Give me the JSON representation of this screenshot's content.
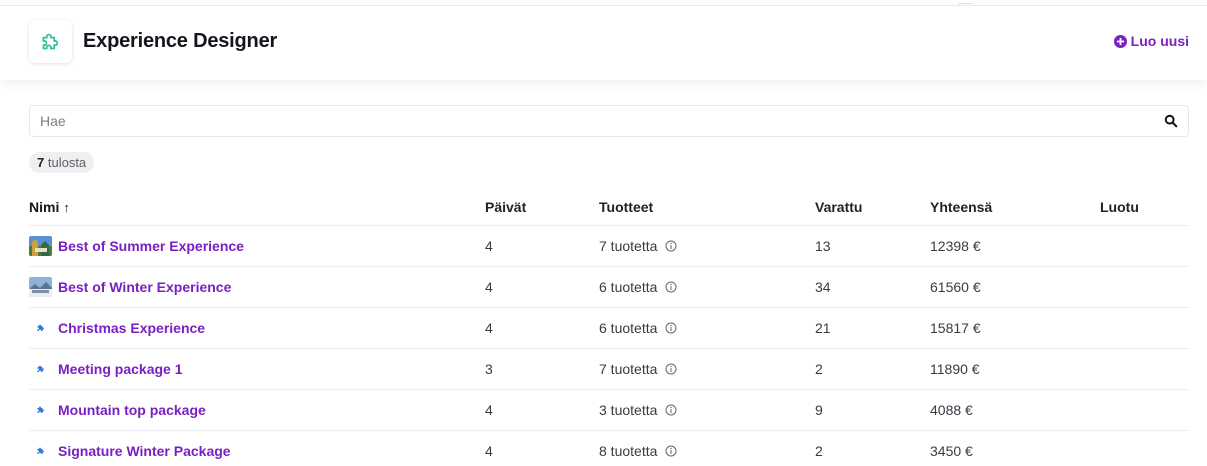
{
  "app": {
    "title": "Experience Designer",
    "new_label": "Luo uusi",
    "accent": "#7a1fc2",
    "logo_icon": "puzzle-icon",
    "logo_color": "#2fbf9b"
  },
  "search": {
    "placeholder": "Hae",
    "value": ""
  },
  "results": {
    "count": "7",
    "label": "tulosta"
  },
  "table": {
    "headers": {
      "name": "Nimi",
      "days": "Päivät",
      "products": "Tuotteet",
      "booked": "Varattu",
      "total": "Yhteensä",
      "created": "Luotu"
    },
    "sort_indicator": "↑",
    "rows": [
      {
        "name": "Best of Summer Experience",
        "days": "4",
        "products": "7 tuotetta",
        "booked": "13",
        "total": "12398 €",
        "icon": "summer-photo-thumbnail"
      },
      {
        "name": "Best of Winter Experience",
        "days": "4",
        "products": "6 tuotetta",
        "booked": "34",
        "total": "61560 €",
        "icon": "winter-photo-thumbnail"
      },
      {
        "name": "Christmas Experience",
        "days": "4",
        "products": "6 tuotetta",
        "booked": "21",
        "total": "15817 €",
        "icon": "puzzle-icon"
      },
      {
        "name": "Meeting package 1",
        "days": "3",
        "products": "7 tuotetta",
        "booked": "2",
        "total": "11890 €",
        "icon": "puzzle-icon"
      },
      {
        "name": "Mountain top package",
        "days": "4",
        "products": "3 tuotetta",
        "booked": "9",
        "total": "4088 €",
        "icon": "puzzle-icon"
      },
      {
        "name": "Signature Winter Package",
        "days": "4",
        "products": "8 tuotetta",
        "booked": "2",
        "total": "3450 €",
        "icon": "puzzle-icon"
      }
    ]
  }
}
